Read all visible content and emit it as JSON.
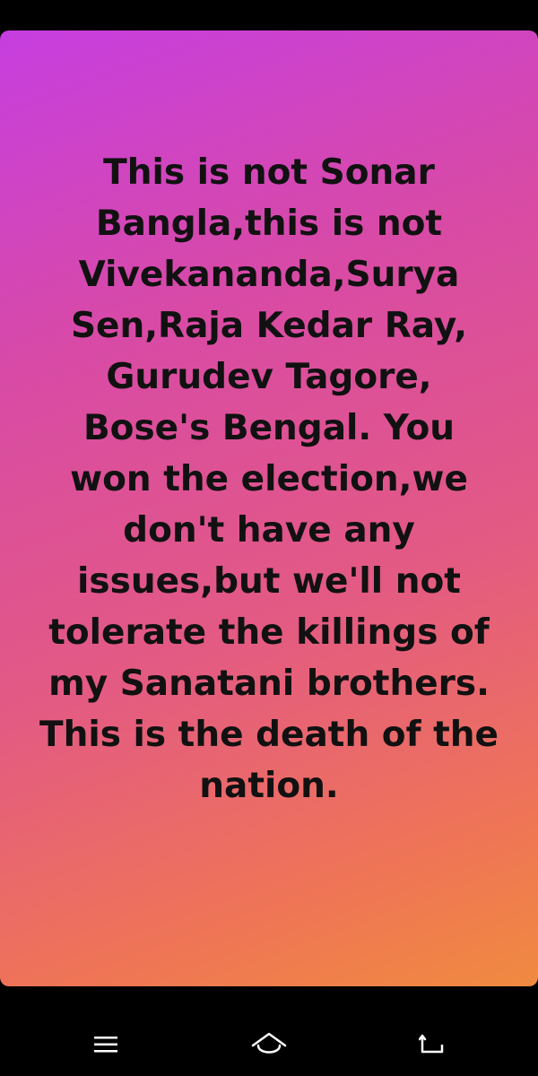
{
  "post": {
    "lines": [
      "This is not Sonar",
      "Bangla,this is not",
      "Vivekananda,Surya",
      "Sen,Raja Kedar Ray,",
      "Gurudev Tagore,",
      "Bose's Bengal. You",
      "won the election,we",
      "don't have any",
      "issues,but we'll not",
      "tolerate the killings of",
      "my Sanatani brothers.",
      "This is the death of the",
      "nation."
    ]
  },
  "colors": {
    "gradient_start": "#c63ee0",
    "gradient_end": "#f08a40",
    "text": "#111111",
    "nav_bar": "#000000",
    "nav_icon": "#ffffff"
  },
  "nav": {
    "menu_icon": "menu-icon",
    "home_icon": "home-icon",
    "back_icon": "back-icon"
  }
}
